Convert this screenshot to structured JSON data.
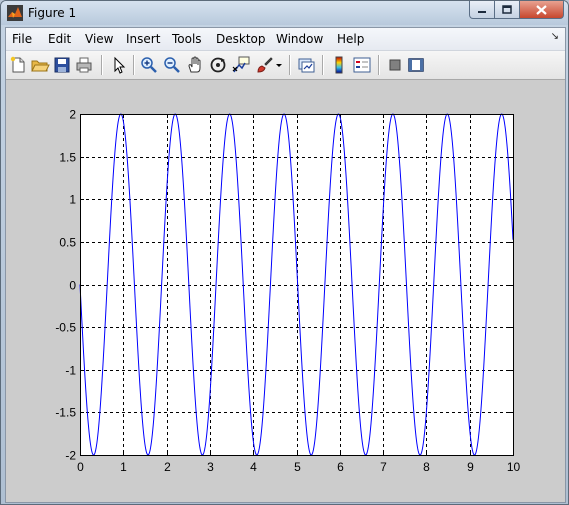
{
  "window": {
    "title": "Figure 1"
  },
  "menu": {
    "items": [
      "File",
      "Edit",
      "View",
      "Insert",
      "Tools",
      "Desktop",
      "Window",
      "Help"
    ]
  },
  "toolbar": {
    "buttons": [
      "new-figure-icon",
      "open-file-icon",
      "save-icon",
      "print-icon",
      "edit-plot-arrow-icon",
      "zoom-in-icon",
      "zoom-out-icon",
      "pan-hand-icon",
      "rotate-3d-icon",
      "data-cursor-icon",
      "brush-icon",
      "brush-dropdown-icon",
      "link-plot-icon",
      "insert-colorbar-icon",
      "insert-legend-icon",
      "hide-plot-tools-icon",
      "show-plot-tools-icon"
    ]
  },
  "colors": {
    "line": "#0000ff",
    "axes_background": "#ffffff",
    "figure_background": "#cccccc",
    "grid": "#000000"
  },
  "chart_data": {
    "type": "line",
    "title": "",
    "xlabel": "",
    "ylabel": "",
    "xlim": [
      0,
      10
    ],
    "ylim": [
      -2,
      2
    ],
    "xticks": [
      "0",
      "1",
      "2",
      "3",
      "4",
      "5",
      "6",
      "7",
      "8",
      "9",
      "10"
    ],
    "yticks": [
      "2",
      "1.5",
      "1",
      "0.5",
      "0",
      "-0.5",
      "-1",
      "-1.5",
      "-2"
    ],
    "grid": true,
    "grid_style": "dashed",
    "series": [
      {
        "function": "y = -2*sin(5*x)",
        "amplitude": 2,
        "angular_frequency": 5,
        "x_start": 0,
        "x_end": 10,
        "sample_step": 0.01
      }
    ]
  }
}
